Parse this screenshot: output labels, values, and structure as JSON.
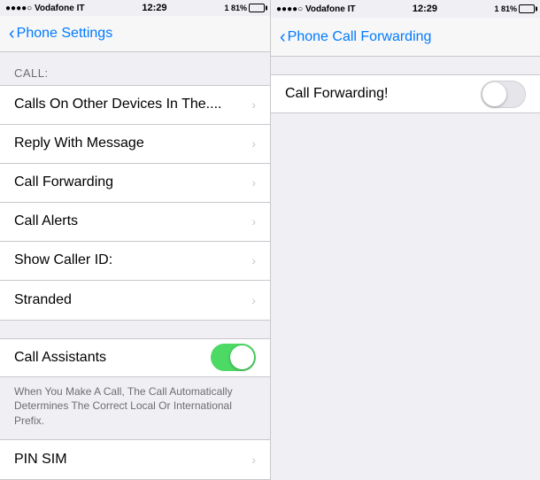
{
  "left": {
    "statusBar": {
      "carrier": "●●●●○ Vodafone IT",
      "time": "12:29",
      "signal": "1 81%"
    },
    "navBar": {
      "backLabel": "Phone Settings",
      "title": ""
    },
    "sectionHeader": "CALL:",
    "items": [
      {
        "label": "Calls On Other Devices In The....",
        "hasChevron": true
      },
      {
        "label": "Reply With Message",
        "hasChevron": true
      },
      {
        "label": "Call Forwarding",
        "hasChevron": true
      },
      {
        "label": "Call Alerts",
        "hasChevron": true
      },
      {
        "label": "Show Caller ID:",
        "hasChevron": true
      },
      {
        "label": "Stranded",
        "hasChevron": true
      }
    ],
    "assistantSection": {
      "label": "Call Assistants",
      "toggleOn": true,
      "description": "When You Make A Call, The Call Automatically Determines The Correct Local Or International Prefix."
    },
    "pinSimLabel": "PIN SIM"
  },
  "right": {
    "statusBar": {
      "carrier": "●●●●○ Vodafone IT",
      "time": "12:29",
      "signal": "1 81%"
    },
    "navBar": {
      "backLabel": "Phone Call Forwarding",
      "title": ""
    },
    "forwardingItem": {
      "label": "Call Forwarding!",
      "toggleOn": false
    }
  },
  "icons": {
    "chevronRight": "›",
    "chevronLeft": "‹"
  }
}
